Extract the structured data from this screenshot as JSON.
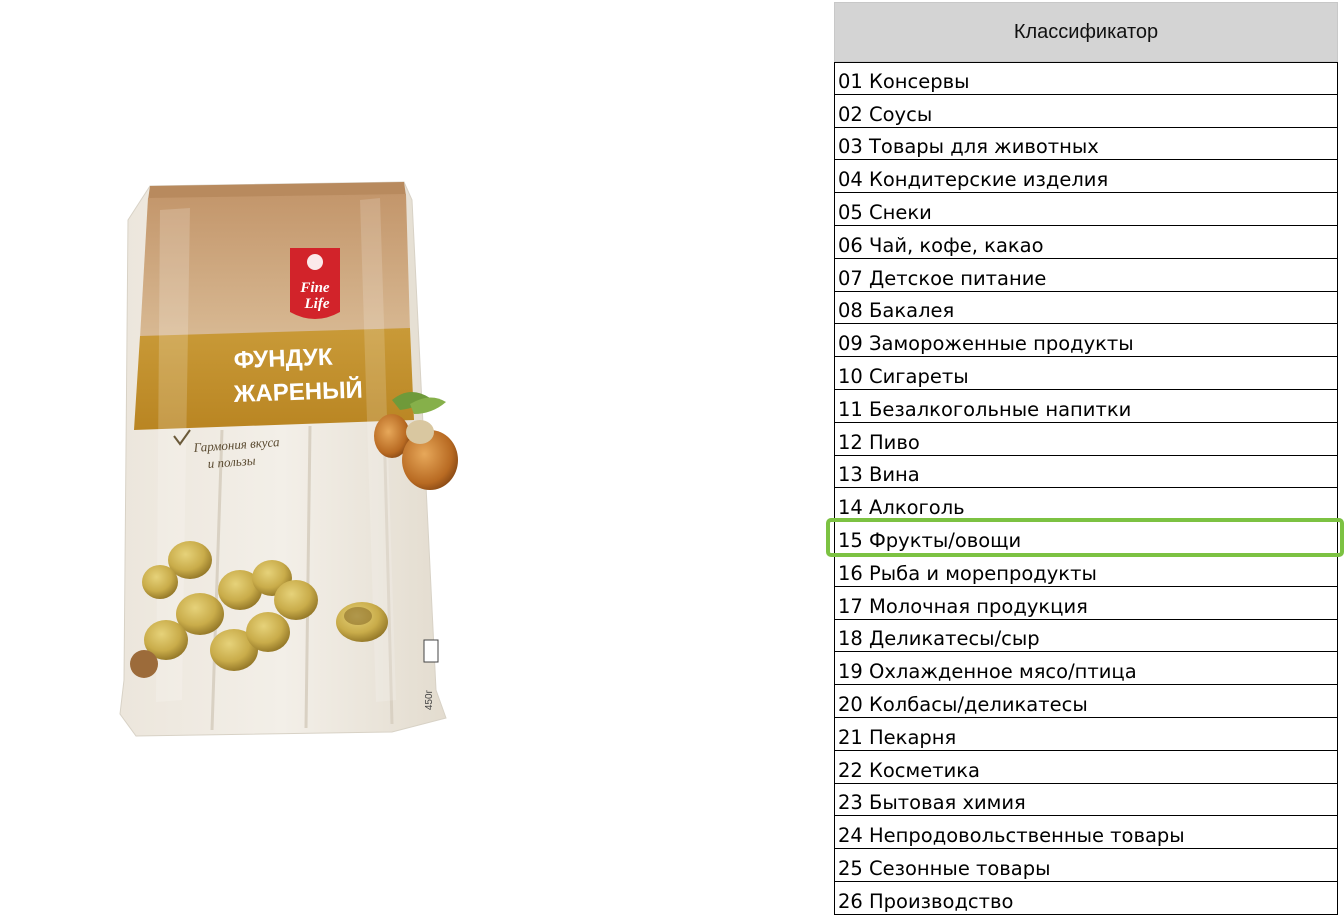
{
  "product": {
    "brand_line1": "Fine",
    "brand_line2": "Life",
    "title_line1": "ФУНДУК",
    "title_line2": "ЖАРЕНЫЙ",
    "tagline_line1": "Гармония вкуса",
    "tagline_line2": "и пользы",
    "weight": "450г"
  },
  "classifier": {
    "header": "Классификатор",
    "selected_index": 14,
    "items": [
      "01 Консервы",
      "02 Соусы",
      "03 Товары для животных",
      "04 Кондитерские изделия",
      "05 Снеки",
      "06 Чай, кофе, какао",
      "07 Детское питание",
      "08 Бакалея",
      "09 Замороженные продукты",
      "10 Сигареты",
      "11 Безалкогольные напитки",
      "12 Пиво",
      "13 Вина",
      "14 Алкоголь",
      "15 Фрукты/овощи",
      "16 Рыба и морепродукты",
      "17 Молочная продукция",
      "18 Деликатесы/сыр",
      "19 Охлажденное мясо/птица",
      "20 Колбасы/деликатесы",
      "21 Пекарня",
      "22 Косметика",
      "23 Бытовая химия",
      "24 Непродовольственные товары",
      "25 Сезонные товары",
      "26 Производство"
    ]
  },
  "colors": {
    "selection_outline": "#7cc242",
    "header_bg": "#d4d4d4",
    "bag_top": "#c9a27a",
    "bag_band": "#c9962e",
    "logo_red": "#d2232a"
  }
}
